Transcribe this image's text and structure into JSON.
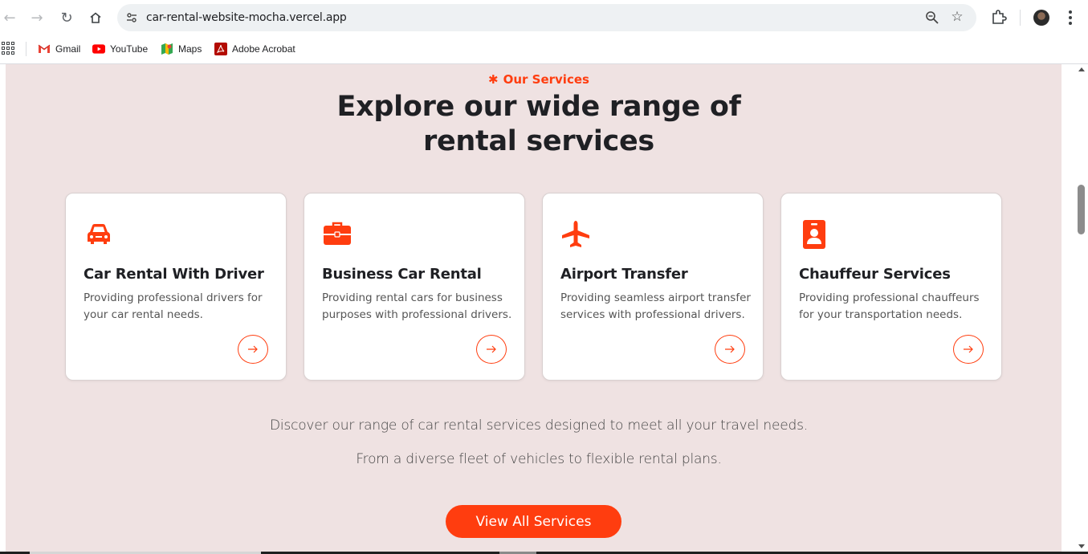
{
  "browser": {
    "url": "car-rental-website-mocha.vercel.app",
    "bookmarks": [
      {
        "label": "Gmail",
        "icon": "gmail-icon"
      },
      {
        "label": "YouTube",
        "icon": "youtube-icon"
      },
      {
        "label": "Maps",
        "icon": "maps-icon"
      },
      {
        "label": "Adobe Acrobat",
        "icon": "acrobat-icon"
      }
    ]
  },
  "services": {
    "eyebrow_symbol": "✱",
    "eyebrow": "Our Services",
    "heading_line1": "Explore our wide range of",
    "heading_line2": "rental services",
    "cards": [
      {
        "icon": "car-icon",
        "title": "Car Rental With Driver",
        "desc": "Providing professional drivers for your car rental needs."
      },
      {
        "icon": "briefcase-icon",
        "title": "Business Car Rental",
        "desc": "Providing rental cars for business purposes with professional drivers."
      },
      {
        "icon": "plane-icon",
        "title": "Airport Transfer",
        "desc": "Providing seamless airport transfer services with professional drivers."
      },
      {
        "icon": "id-badge-icon",
        "title": "Chauffeur Services",
        "desc": "Providing professional chauffeurs for your transportation needs."
      }
    ],
    "paragraph1": "Discover our range of car rental services designed to meet all your travel needs.",
    "paragraph2": "From a diverse fleet of vehicles to flexible rental plans.",
    "cta_label": "View All Services"
  },
  "colors": {
    "accent": "#ff3d0f",
    "section_bg": "#efe2e2",
    "heading": "#1f2024"
  }
}
